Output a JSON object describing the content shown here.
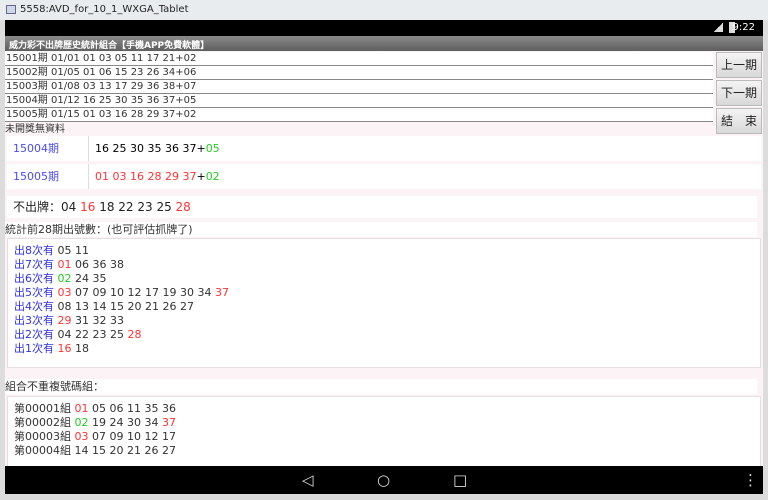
{
  "window": {
    "title": "5558:AVD_for_10_1_WXGA_Tablet"
  },
  "status": {
    "time": "9:22"
  },
  "app": {
    "title": "威力彩不出牌歷史統計組合【手機APP免費軟體】"
  },
  "history": [
    "15001期 01/01 01 03 05 11 17 21+02",
    "15002期 01/05 01 06 15 23 26 34+06",
    "15003期 01/08 03 13 17 29 36 38+07",
    "15004期 01/12 16 25 30 35 36 37+05",
    "15005期 01/15 01 03 16 28 29 37+02"
  ],
  "no_data": "未開獎無資料",
  "buttons": {
    "prev": "上一期",
    "next": "下一期",
    "end": "結　束"
  },
  "cards": [
    {
      "period": "15004期 01/12",
      "nums": [
        {
          "t": "16 25 30 35 36 37+",
          "c": ""
        },
        {
          "t": "05",
          "c": "green"
        }
      ]
    },
    {
      "period": "15005期 01/15",
      "nums": [
        {
          "t": "01 03 16 28 29 37",
          "c": "red"
        },
        {
          "t": "+",
          "c": ""
        },
        {
          "t": "02",
          "c": "green"
        }
      ]
    }
  ],
  "missing": {
    "label": "不出牌：",
    "nums": [
      {
        "t": "04 ",
        "c": ""
      },
      {
        "t": "16",
        "c": "red"
      },
      {
        "t": " 18 22 23 25 ",
        "c": ""
      },
      {
        "t": "28",
        "c": "red"
      }
    ]
  },
  "stats_label": "統計前28期出號數：(也可評估抓牌了)",
  "stats": [
    {
      "label": "出8次有 ",
      "nums": [
        {
          "t": "05 11",
          "c": ""
        }
      ]
    },
    {
      "label": "出7次有 ",
      "nums": [
        {
          "t": "01",
          "c": "red"
        },
        {
          "t": " 06 36 38",
          "c": ""
        }
      ]
    },
    {
      "label": "出6次有 ",
      "nums": [
        {
          "t": "02",
          "c": "green"
        },
        {
          "t": " 24 35",
          "c": ""
        }
      ]
    },
    {
      "label": "出5次有 ",
      "nums": [
        {
          "t": "03",
          "c": "red"
        },
        {
          "t": " 07 09 10 12 17 19 30 34 ",
          "c": ""
        },
        {
          "t": "37",
          "c": "red"
        }
      ]
    },
    {
      "label": "出4次有 ",
      "nums": [
        {
          "t": "08 13 14 15 20 21 26 27",
          "c": ""
        }
      ]
    },
    {
      "label": "出3次有 ",
      "nums": [
        {
          "t": "29",
          "c": "red"
        },
        {
          "t": " 31 32 33",
          "c": ""
        }
      ]
    },
    {
      "label": "出2次有 ",
      "nums": [
        {
          "t": "04 22 23 25 ",
          "c": ""
        },
        {
          "t": "28",
          "c": "red"
        }
      ]
    },
    {
      "label": "出1次有 ",
      "nums": [
        {
          "t": "16",
          "c": "red"
        },
        {
          "t": " 18",
          "c": ""
        }
      ]
    }
  ],
  "combo_label": "組合不重複號碼組：",
  "combos": [
    {
      "label": "第00001組 ",
      "nums": [
        {
          "t": "01",
          "c": "red"
        },
        {
          "t": " 05 06 11 35 36",
          "c": ""
        }
      ]
    },
    {
      "label": "第00002組 ",
      "nums": [
        {
          "t": "02",
          "c": "green"
        },
        {
          "t": " 19 24 30 34 ",
          "c": ""
        },
        {
          "t": "37",
          "c": "red"
        }
      ]
    },
    {
      "label": "第00003組 ",
      "nums": [
        {
          "t": "03",
          "c": "red"
        },
        {
          "t": " 07 09 10 12 17",
          "c": ""
        }
      ]
    },
    {
      "label": "第00004組 ",
      "nums": [
        {
          "t": "14 15 20 21 26 27",
          "c": ""
        }
      ]
    }
  ],
  "nav": {
    "back": "◁",
    "home": "○",
    "recents": "□",
    "menu": "⋮"
  }
}
